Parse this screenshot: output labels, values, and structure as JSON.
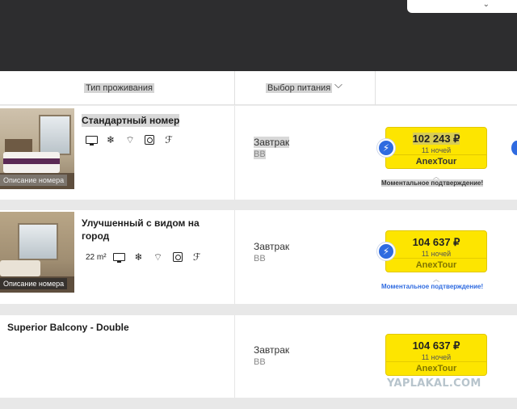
{
  "header": {
    "accommodation_type": "Тип проживания",
    "meal_choice": "Выбор питания"
  },
  "rooms": [
    {
      "name": "Стандартный номер",
      "photo_caption": "Описание номера",
      "area": "",
      "meal": "Завтрак",
      "meal_code": "BB",
      "price": "102 243 ₽",
      "nights": "11 ночей",
      "operator": "AnexTour",
      "instant_confirmation": "Моментальное подтверждение!"
    },
    {
      "name": "Улучшенный с видом на город",
      "photo_caption": "Описание номера",
      "area": "22 m²",
      "meal": "Завтрак",
      "meal_code": "BB",
      "price": "104 637 ₽",
      "nights": "11 ночей",
      "operator": "AnexTour",
      "instant_confirmation": "Моментальное подтверждение!"
    },
    {
      "name": "Superior Balcony - Double",
      "meal": "Завтрак",
      "meal_code": "BB",
      "price": "104 637 ₽",
      "nights": "11 ночей",
      "operator": "AnexTour"
    }
  ],
  "amenity_icons": [
    "tv-icon",
    "air-conditioning-icon",
    "wifi-icon",
    "safe-icon",
    "hairdryer-icon"
  ],
  "watermark": "YAPLAKAL.COM",
  "colors": {
    "price_button": "#fde500",
    "accent_blue": "#2f6be0",
    "topbar": "#2d2d2f"
  }
}
